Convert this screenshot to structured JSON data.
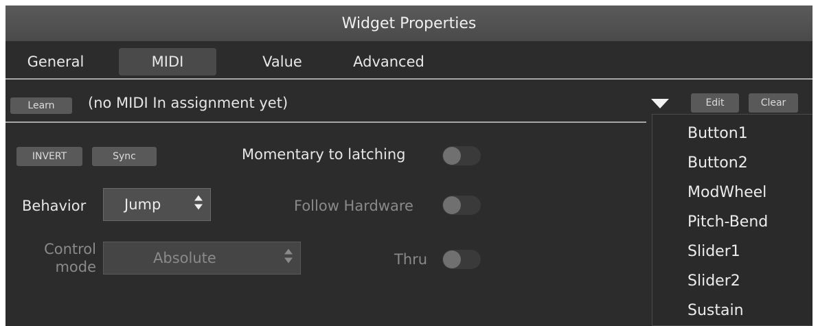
{
  "title": "Widget Properties",
  "tabs": [
    "General",
    "MIDI",
    "Value",
    "Advanced"
  ],
  "active_tab": "MIDI",
  "assignment": {
    "learn_label": "Learn",
    "status_text": "(no MIDI In assignment yet)",
    "edit_label": "Edit",
    "clear_label": "Clear"
  },
  "controls": {
    "invert_label": "INVERT",
    "sync_label": "Sync",
    "momentary_label": "Momentary to latching",
    "momentary_on": false,
    "behavior_label": "Behavior",
    "behavior_value": "Jump",
    "follow_hardware_label": "Follow Hardware",
    "follow_hardware_on": false,
    "control_mode_label_line1": "Control",
    "control_mode_label_line2": "mode",
    "control_mode_value": "Absolute",
    "thru_label": "Thru",
    "thru_on": false
  },
  "dropdown_menu": {
    "items": [
      "Button1",
      "Button2",
      "ModWheel",
      "Pitch-Bend",
      "Slider1",
      "Slider2",
      "Sustain"
    ]
  }
}
